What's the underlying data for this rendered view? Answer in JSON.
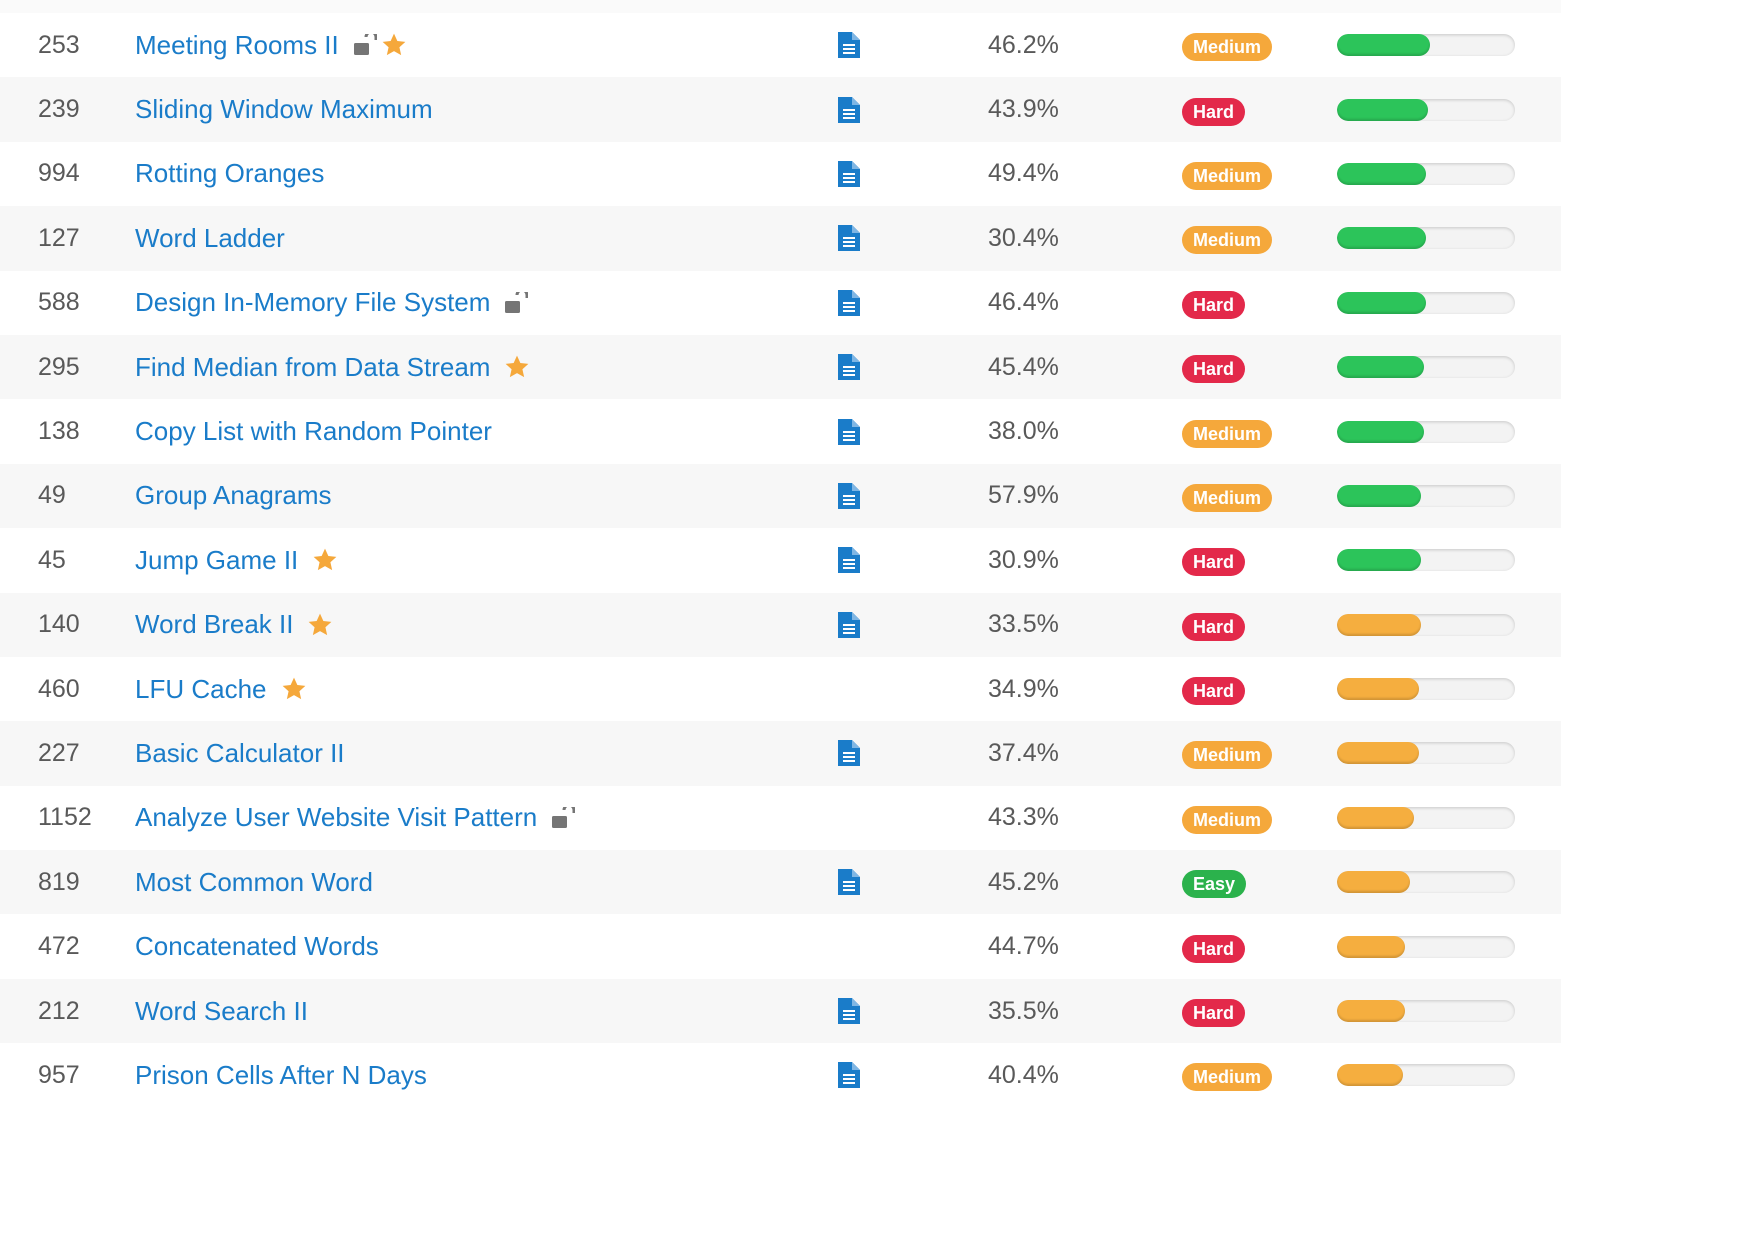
{
  "colors": {
    "link": "#1a7cc9",
    "easy": "#2bb24c",
    "medium": "#f5a83b",
    "hard": "#e3294a",
    "bar_high": "#2cc45a",
    "bar_mid": "#f5ae3f",
    "doc_icon": "#1a7cc9",
    "lock_icon": "#757575",
    "star_icon": "#f5a83b"
  },
  "problems": [
    {
      "id": "253",
      "title": "Meeting Rooms II",
      "locked": true,
      "starred": true,
      "solution": true,
      "acceptance": "46.2%",
      "difficulty": "Medium",
      "frequency": 0.52,
      "freq_level": "high"
    },
    {
      "id": "239",
      "title": "Sliding Window Maximum",
      "locked": false,
      "starred": false,
      "solution": true,
      "acceptance": "43.9%",
      "difficulty": "Hard",
      "frequency": 0.51,
      "freq_level": "high"
    },
    {
      "id": "994",
      "title": "Rotting Oranges",
      "locked": false,
      "starred": false,
      "solution": true,
      "acceptance": "49.4%",
      "difficulty": "Medium",
      "frequency": 0.5,
      "freq_level": "high"
    },
    {
      "id": "127",
      "title": "Word Ladder",
      "locked": false,
      "starred": false,
      "solution": true,
      "acceptance": "30.4%",
      "difficulty": "Medium",
      "frequency": 0.5,
      "freq_level": "high"
    },
    {
      "id": "588",
      "title": "Design In-Memory File System",
      "locked": true,
      "starred": false,
      "solution": true,
      "acceptance": "46.4%",
      "difficulty": "Hard",
      "frequency": 0.5,
      "freq_level": "high"
    },
    {
      "id": "295",
      "title": "Find Median from Data Stream",
      "locked": false,
      "starred": true,
      "solution": true,
      "acceptance": "45.4%",
      "difficulty": "Hard",
      "frequency": 0.49,
      "freq_level": "high"
    },
    {
      "id": "138",
      "title": "Copy List with Random Pointer",
      "locked": false,
      "starred": false,
      "solution": true,
      "acceptance": "38.0%",
      "difficulty": "Medium",
      "frequency": 0.49,
      "freq_level": "high"
    },
    {
      "id": "49",
      "title": "Group Anagrams",
      "locked": false,
      "starred": false,
      "solution": true,
      "acceptance": "57.9%",
      "difficulty": "Medium",
      "frequency": 0.47,
      "freq_level": "high"
    },
    {
      "id": "45",
      "title": "Jump Game II",
      "locked": false,
      "starred": true,
      "solution": true,
      "acceptance": "30.9%",
      "difficulty": "Hard",
      "frequency": 0.47,
      "freq_level": "high"
    },
    {
      "id": "140",
      "title": "Word Break II",
      "locked": false,
      "starred": true,
      "solution": true,
      "acceptance": "33.5%",
      "difficulty": "Hard",
      "frequency": 0.47,
      "freq_level": "mid"
    },
    {
      "id": "460",
      "title": "LFU Cache",
      "locked": false,
      "starred": true,
      "solution": false,
      "acceptance": "34.9%",
      "difficulty": "Hard",
      "frequency": 0.46,
      "freq_level": "mid"
    },
    {
      "id": "227",
      "title": "Basic Calculator II",
      "locked": false,
      "starred": false,
      "solution": true,
      "acceptance": "37.4%",
      "difficulty": "Medium",
      "frequency": 0.46,
      "freq_level": "mid"
    },
    {
      "id": "1152",
      "title": "Analyze User Website Visit Pattern",
      "locked": true,
      "starred": false,
      "solution": false,
      "acceptance": "43.3%",
      "difficulty": "Medium",
      "frequency": 0.43,
      "freq_level": "mid"
    },
    {
      "id": "819",
      "title": "Most Common Word",
      "locked": false,
      "starred": false,
      "solution": true,
      "acceptance": "45.2%",
      "difficulty": "Easy",
      "frequency": 0.41,
      "freq_level": "mid"
    },
    {
      "id": "472",
      "title": "Concatenated Words",
      "locked": false,
      "starred": false,
      "solution": false,
      "acceptance": "44.7%",
      "difficulty": "Hard",
      "frequency": 0.38,
      "freq_level": "mid"
    },
    {
      "id": "212",
      "title": "Word Search II",
      "locked": false,
      "starred": false,
      "solution": true,
      "acceptance": "35.5%",
      "difficulty": "Hard",
      "frequency": 0.38,
      "freq_level": "mid"
    },
    {
      "id": "957",
      "title": "Prison Cells After N Days",
      "locked": false,
      "starred": false,
      "solution": true,
      "acceptance": "40.4%",
      "difficulty": "Medium",
      "frequency": 0.37,
      "freq_level": "mid"
    }
  ]
}
